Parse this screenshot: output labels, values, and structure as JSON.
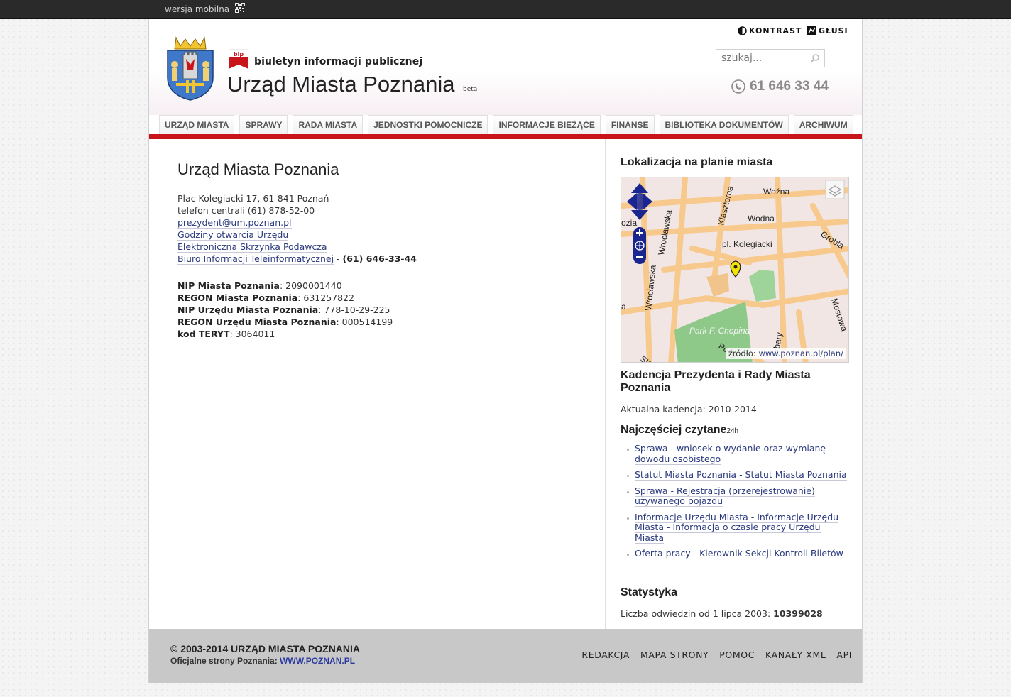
{
  "topbar": {
    "mobile_label": "wersja mobilna"
  },
  "header": {
    "bip_text": "biuletyn informacji publicznej",
    "title": "Urząd Miasta Poznania",
    "beta": "beta",
    "kontrast": "KONTRAST",
    "glusi": "GŁUSI",
    "search_placeholder": "szukaj...",
    "phone": "61 646 33 44"
  },
  "nav": {
    "items": [
      "URZĄD MIASTA",
      "SPRAWY",
      "RADA MIASTA",
      "JEDNOSTKI POMOCNICZE",
      "INFORMACJE BIEŻĄCE",
      "FINANSE",
      "BIBLIOTEKA DOKUMENTÓW",
      "ARCHIWUM"
    ]
  },
  "main": {
    "heading": "Urząd Miasta Poznania",
    "address": "Plac Kolegiacki 17, 61-841 Poznań",
    "phone_central": "telefon centrali (61) 878-52-00",
    "email": "prezydent@um.poznan.pl",
    "hours_link": "Godziny otwarcia Urzędu",
    "epuap_link": "Elektroniczna Skrzynka Podawcza",
    "bit_link": "Biuro Informacji Teleinformatycznej",
    "bit_sep": " - ",
    "bit_phone": "(61) 646-33-44",
    "ids": [
      {
        "label": "NIP Miasta Poznania",
        "value": "2090001440"
      },
      {
        "label": "REGON Miasta Poznania",
        "value": "631257822"
      },
      {
        "label": "NIP Urzędu Miasta Poznania",
        "value": "778-10-29-225"
      },
      {
        "label": "REGON Urzędu Miasta Poznania",
        "value": "000514199"
      },
      {
        "label": "kod TERYT",
        "value": "3064011"
      }
    ]
  },
  "sidebar": {
    "map_heading": "Lokalizacja na planie miasta",
    "map": {
      "streets": [
        "Woźna",
        "Wodna",
        "Klasztorna",
        "Wrocławska",
        "Grobla",
        "pl. Kolegiacki",
        "Park F. Chopina",
        "Mostowa",
        "ozia",
        "a",
        "Podg",
        "rbary",
        "Sta"
      ],
      "source_label": "źródło:",
      "source_link": "www.poznan.pl/plan/"
    },
    "term_heading": "Kadencja Prezydenta i Rady Miasta Poznania",
    "term_text": "Aktualna kadencja: 2010-2014",
    "top_heading": "Najczęściej czytane",
    "top_heading_suffix": "24h",
    "top_items": [
      "Sprawa - wniosek o wydanie oraz wymianę dowodu osobistego",
      "Statut Miasta Poznania - Statut Miasta Poznania",
      "Sprawa - Rejestracja (przerejestrowanie) używanego pojazdu",
      "Informacje Urzędu Miasta - Informacje Urzędu Miasta - Informacja o czasie pracy Urzędu Miasta",
      "Oferta pracy - Kierownik Sekcji Kontroli Biletów"
    ],
    "stats_heading": "Statystyka",
    "stats_label": "Liczba odwiedzin od 1 lipca 2003:",
    "stats_value": "10399028"
  },
  "footer": {
    "copyright": "© 2003-2014 URZĄD MIASTA POZNANIA",
    "official_label": "Oficjalne strony Poznania:",
    "official_link": "WWW.POZNAN.PL",
    "links": [
      "REDAKCJA",
      "MAPA STRONY",
      "POMOC",
      "KANAŁY XML",
      "API"
    ]
  },
  "colors": {
    "accent_red": "#c8151b",
    "link": "#2b3a7e",
    "footer_bg": "#c8c8c8"
  }
}
